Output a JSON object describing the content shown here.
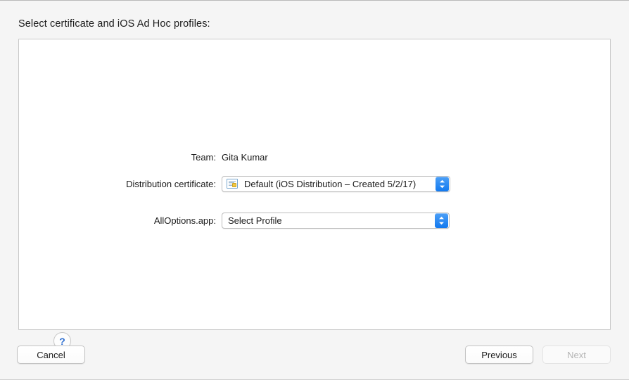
{
  "window": {
    "title": "Select certificate and iOS Ad Hoc profiles:"
  },
  "form": {
    "rows": [
      {
        "label": "Team:",
        "type": "static",
        "value": "Gita Kumar"
      },
      {
        "label": "Distribution certificate:",
        "type": "popup",
        "value": "Default (iOS Distribution – Created 5/2/17)",
        "icon": "certificate-icon"
      },
      {
        "label": "AllOptions.app:",
        "type": "popup",
        "value": "Select Profile"
      }
    ]
  },
  "help": {
    "label": "?",
    "icon": "question-mark-icon"
  },
  "buttons": {
    "cancel": "Cancel",
    "previous": "Previous",
    "next": "Next"
  },
  "colors": {
    "accent": "#1279ef",
    "help_glyph": "#2f6fd0",
    "panel_background": "#ffffff",
    "sheet_background": "#f5f5f5",
    "disabled_text": "#b4b4b4"
  }
}
